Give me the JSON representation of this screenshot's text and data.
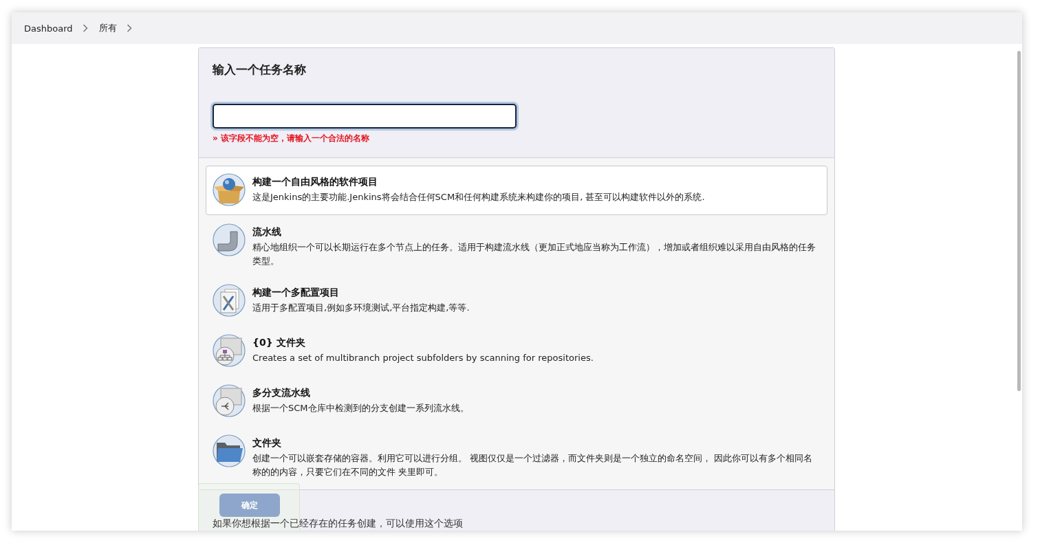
{
  "breadcrumbs": [
    {
      "label": "Dashboard"
    },
    {
      "label": "所有"
    }
  ],
  "form": {
    "title": "输入一个任务名称",
    "name_field": {
      "focused": true
    },
    "error": "» 该字段不能为空，请输入一个合法的名称"
  },
  "item_types": [
    {
      "title": "构建一个自由风格的软件项目",
      "description": "这是Jenkins的主要功能.Jenkins将会结合任何SCM和任何构建系统来构建你的项目, 甚至可以构建软件以外的系统.",
      "selected": true
    },
    {
      "title": "流水线",
      "description": "精心地组织一个可以长期运行在多个节点上的任务。适用于构建流水线（更加正式地应当称为工作流），增加或者组织难以采用自由风格的任务类型。",
      "selected": false
    },
    {
      "title": "构建一个多配置项目",
      "description": "适用于多配置项目,例如多环境测试,平台指定构建,等等.",
      "selected": false
    },
    {
      "title": "{0} 文件夹",
      "description": "Creates a set of multibranch project subfolders by scanning for repositories.",
      "selected": false
    },
    {
      "title": "多分支流水线",
      "description": "根据一个SCM仓库中检测到的分支创建一系列流水线。",
      "selected": false
    },
    {
      "title": "文件夹",
      "description": "创建一个可以嵌套存储的容器。利用它可以进行分组。 视图仅仅是一个过滤器，而文件夹则是一个独立的命名空间， 因此你可以有多个相同名称的的内容，只要它们在不同的文件 夹里即可。",
      "selected": false
    }
  ],
  "copy_option": {
    "label": "如果你想根据一个已经存在的任务创建，可以使用这个选项"
  },
  "confirm_button": {
    "label": "确定",
    "disabled": true
  }
}
